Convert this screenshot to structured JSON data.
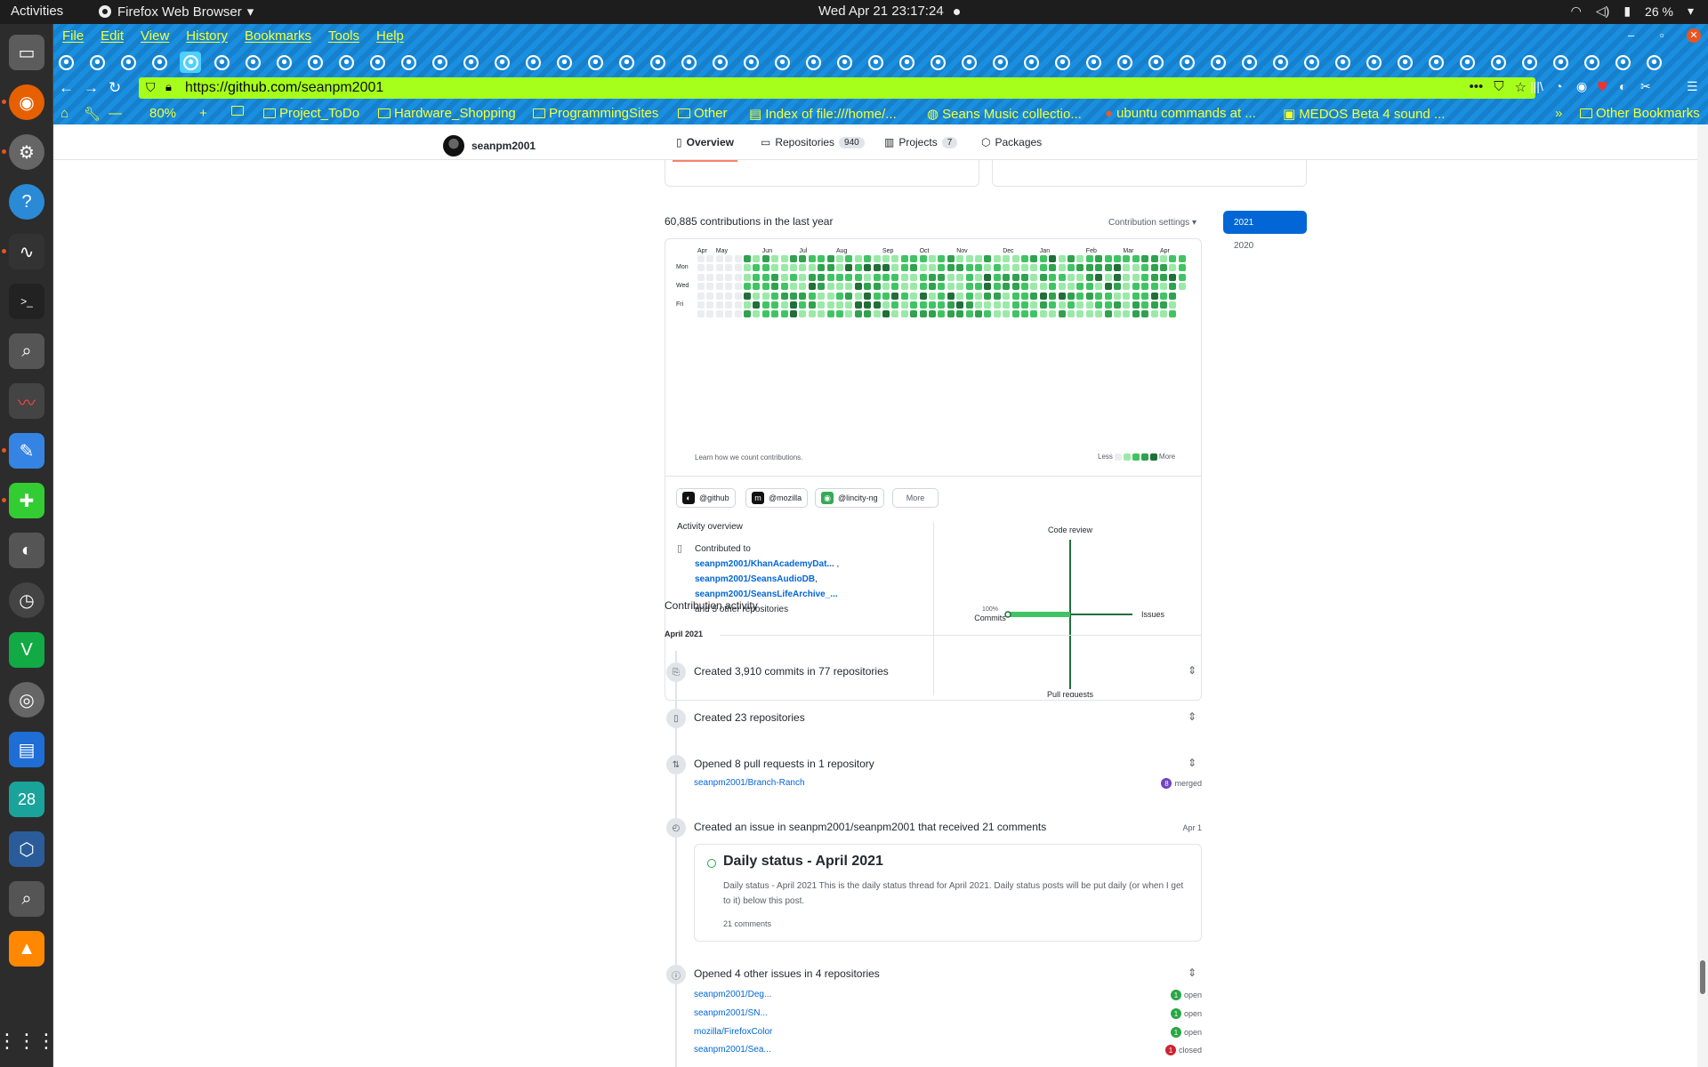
{
  "topbar": {
    "activities": "Activities",
    "app_name": "Firefox Web Browser",
    "clock": "Wed Apr 21  23:17:24",
    "battery": "26 %"
  },
  "firefox": {
    "menus": [
      "File",
      "Edit",
      "View",
      "History",
      "Bookmarks",
      "Tools",
      "Help"
    ],
    "url_prefix": "https://",
    "url_domain": "github.com",
    "url_path": "/seanpm2001",
    "zoom": "80%",
    "bookmarks": [
      {
        "label": "Project_ToDo",
        "icon": "folder-icon"
      },
      {
        "label": "Hardware_Shopping",
        "icon": "folder-icon"
      },
      {
        "label": "ProgrammingSites",
        "icon": "folder-icon"
      },
      {
        "label": "Other",
        "icon": "folder-icon"
      },
      {
        "label": "Index of file:///home/...",
        "icon": "file-icon"
      },
      {
        "label": "Seans Music collectio...",
        "icon": "globe-icon"
      },
      {
        "label": "ubuntu commands at ...",
        "icon": "duckduckgo-icon"
      },
      {
        "label": "MEDOS Beta 4 sound ...",
        "icon": "image-icon"
      }
    ],
    "other_bookmarks": "Other Bookmarks"
  },
  "github": {
    "username": "seanpm2001",
    "tabs": [
      {
        "label": "Overview",
        "count": ""
      },
      {
        "label": "Repositories",
        "count": "940"
      },
      {
        "label": "Projects",
        "count": "7"
      },
      {
        "label": "Packages",
        "count": ""
      }
    ],
    "contributions_title": "60,885 contributions in the last year",
    "contribution_settings": "Contribution settings ▾",
    "years": [
      "2021",
      "2020"
    ],
    "calendar": {
      "months": [
        "Apr",
        "May",
        "Jun",
        "Jul",
        "Aug",
        "Sep",
        "Oct",
        "Nov",
        "Dec",
        "Jan",
        "Feb",
        "Mar",
        "Apr"
      ],
      "days": [
        "Mon",
        "Wed",
        "Fri"
      ],
      "learn": "Learn how we count contributions.",
      "less": "Less",
      "more": "More",
      "colors": [
        "#ebedf0",
        "#9be9a8",
        "#40c463",
        "#30a14e",
        "#216e39"
      ]
    },
    "orgs": [
      "@github",
      "@mozilla",
      "@lincity-ng",
      "More"
    ],
    "activity_overview": {
      "title": "Activity overview",
      "contributed_to": "Contributed to",
      "repos": [
        "seanpm2001/KhanAcademyDat...",
        "seanpm2001/SeansAudioDB",
        "seanpm2001/SeansLifeArchive_..."
      ],
      "others": "and 5 other repositories",
      "radar": {
        "code_review": "Code review",
        "issues": "Issues",
        "pull_requests": "Pull requests",
        "commits": "Commits",
        "commits_pct": "100%"
      }
    },
    "contribution_activity": {
      "title": "Contribution activity",
      "month": "April 2021",
      "items": {
        "commits": "Created 3,910 commits in 77 repositories",
        "repos": "Created 23 repositories",
        "prs": "Opened 8 pull requests in 1 repository",
        "pr_repo": "seanpm2001/Branch-Ranch",
        "pr_count": "8",
        "pr_state": "merged",
        "issue": "Created an issue in seanpm2001/seanpm2001 that received 21 comments",
        "issue_date": "Apr 1",
        "issue_title": "Daily status - April 2021",
        "issue_desc": "Daily status - April 2021 This is the daily status thread for April 2021. Daily status posts will be put daily (or when I get to it) below this post.",
        "issue_comments": "21 comments",
        "other_issues": "Opened 4 other issues in 4 repositories",
        "other_issue_list": [
          {
            "repo": "seanpm2001/Deg...",
            "count": "1",
            "state": "open"
          },
          {
            "repo": "seanpm2001/SN...",
            "count": "1",
            "state": "open"
          },
          {
            "repo": "mozilla/FirefoxColor",
            "count": "1",
            "state": "open"
          },
          {
            "repo": "seanpm2001/Sea...",
            "count": "1",
            "state": "closed"
          }
        ]
      }
    }
  }
}
